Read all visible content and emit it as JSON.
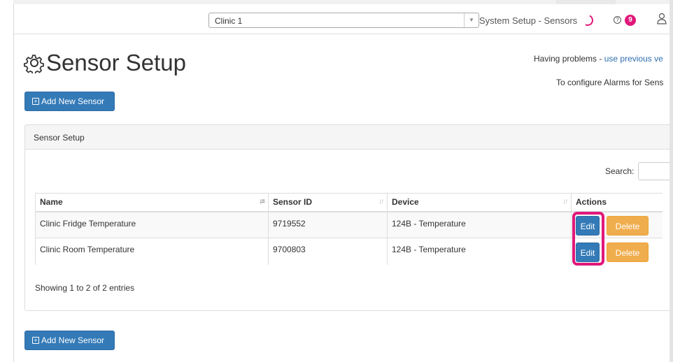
{
  "navbar": {
    "clinic_selected": "Clinic 1",
    "section_title": "System Setup - Sensors",
    "notification_count": "9"
  },
  "header": {
    "title": "Sensor Setup",
    "problems_text": "Having problems - ",
    "problems_link": "use previous ve",
    "alarms_text": "To configure Alarms for Sens"
  },
  "buttons": {
    "add_new_sensor": "Add New Sensor"
  },
  "panel": {
    "heading": "Sensor Setup",
    "search_label": "Search:",
    "search_value": "",
    "columns": [
      "Name",
      "Sensor ID",
      "Device",
      "Actions"
    ],
    "rows": [
      {
        "name": "Clinic Fridge Temperature",
        "sensor_id": "9719552",
        "device": "124B - Temperature",
        "edit": "Edit",
        "delete": "Delete"
      },
      {
        "name": "Clinic Room Temperature",
        "sensor_id": "9700803",
        "device": "124B - Temperature",
        "edit": "Edit",
        "delete": "Delete"
      }
    ],
    "showing": "Showing 1 to 2 of 2 entries"
  },
  "colors": {
    "primary": "#337ab7",
    "warning": "#f0ad4e",
    "highlight": "#e0187a"
  }
}
